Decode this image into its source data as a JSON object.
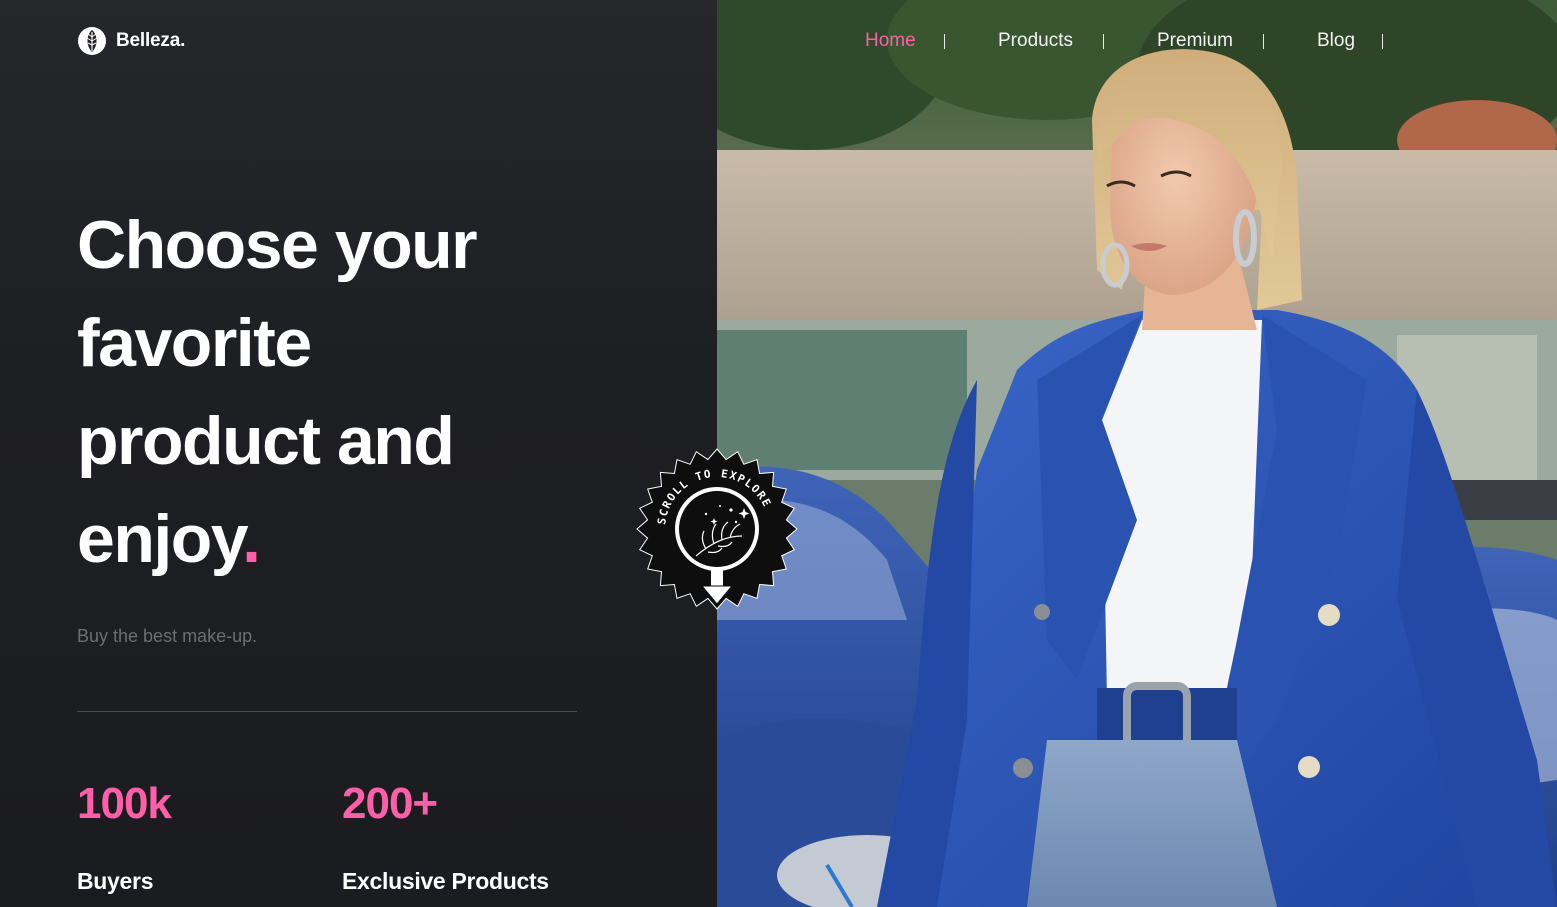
{
  "brand": {
    "name": "Belleza."
  },
  "nav": {
    "items": [
      {
        "label": "Home",
        "active": true
      },
      {
        "label": "Products",
        "active": false
      },
      {
        "label": "Premium",
        "active": false
      },
      {
        "label": "Blog",
        "active": false
      }
    ]
  },
  "hero": {
    "headline_lines": [
      "Choose your",
      "favorite",
      "product and",
      "enjoy"
    ],
    "headline_dot": ".",
    "subtitle": "Buy the best make-up."
  },
  "stats": [
    {
      "value": "100k",
      "label": "Buyers"
    },
    {
      "value": "200+",
      "label": "Exclusive Products"
    }
  ],
  "badge": {
    "text": "SCROLL TO EXPLORE",
    "icon": "arrow-down-icon"
  },
  "colors": {
    "accent": "#ff5fa8",
    "panel": "#1e1f22",
    "jacket": "#2c55b0"
  }
}
